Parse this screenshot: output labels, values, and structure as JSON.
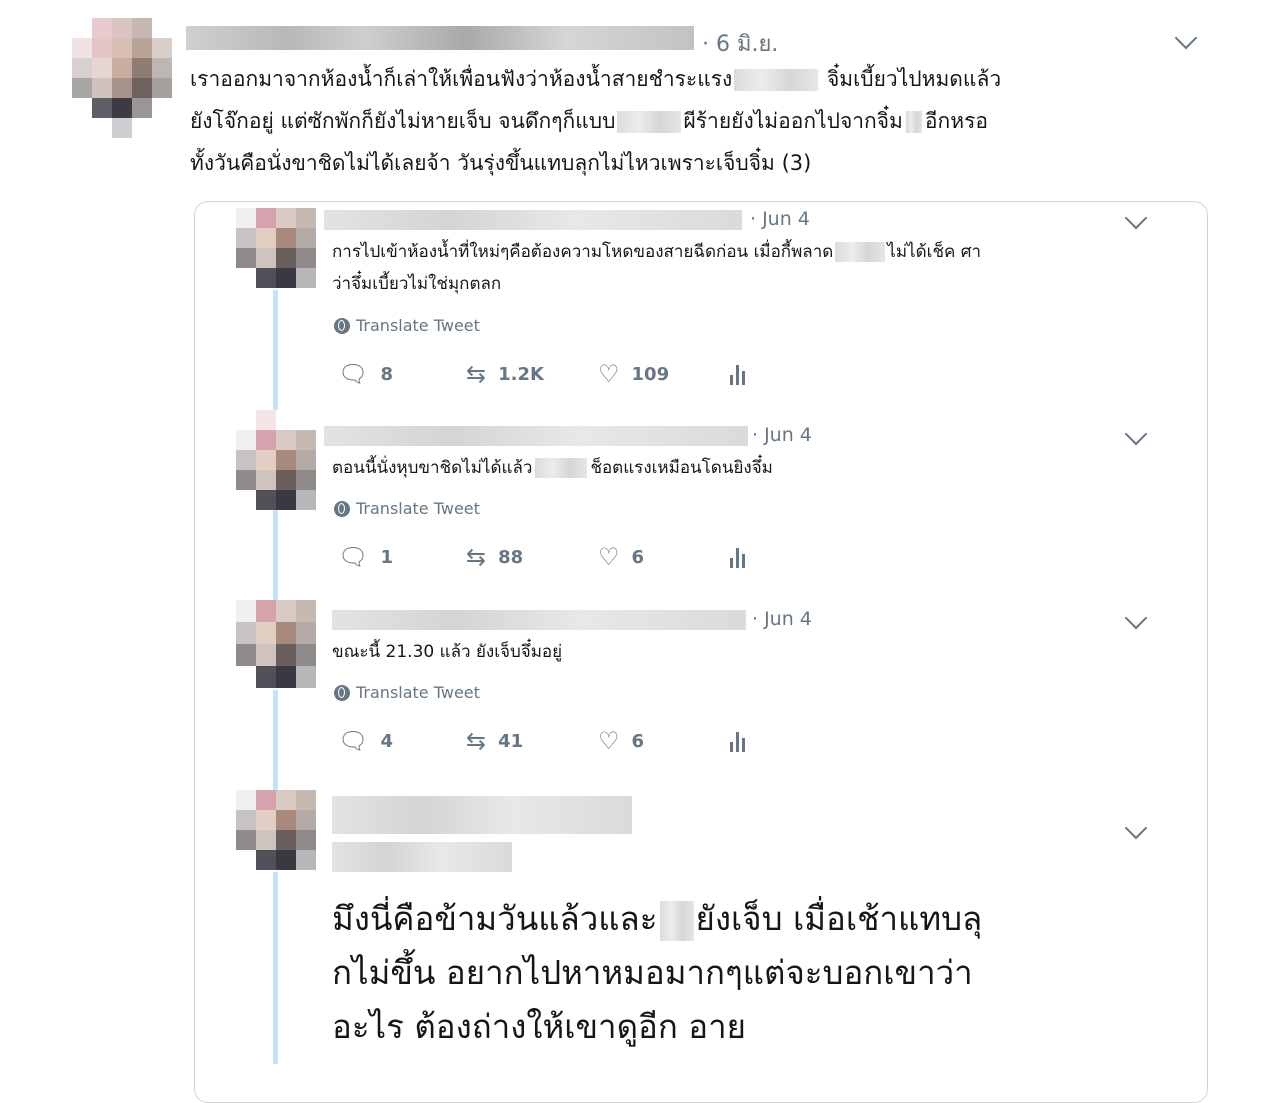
{
  "main_tweet": {
    "date": "· 6 มิ.ย.",
    "lines": [
      [
        "เราออกมาจากห้องน้ำก็เล่าให้เพื่อนฟังว่าห้องน้ำสายชำระแรง",
        " จิ๋มเบี้ยวไปหมดแล้ว"
      ],
      [
        "ยังโจ๊กอยู่ แต่ซักพักก็ยังไม่หายเจ็บ จนดึกๆก็แบบ",
        "ผีร้ายยังไม่ออกไปจากจิ๋ม",
        "อีกหรอ"
      ],
      [
        "ทั้งวันคือนั่งขาชิดไม่ได้เลยจ้า วันรุ่งขึ้นแทบลุกไม่ไหวเพราะเจ็บจิ๋ม (3)"
      ]
    ]
  },
  "replies": [
    {
      "date": "· Jun 4",
      "line1": "การไปเข้าห้องน้ำที่ใหม่ๆคือต้องความโหดของสายฉีดก่อน เมื่อกี้พลาด",
      "line1b": "ไม่ได้เช็ค ศา",
      "line2": "ว่าจึ๋มเบี้ยวไม่ใช่มุกตลก",
      "translate": "Translate Tweet",
      "replies": "8",
      "retweets": "1.2K",
      "likes": "109"
    },
    {
      "date": "· Jun 4",
      "line1": "ตอนนี้นั่งหุบขาชิดไม่ได้แล้ว",
      "line1b": "ช็อตแรงเหมือนโดนยิงจึ๋ม",
      "translate": "Translate Tweet",
      "replies": "1",
      "retweets": "88",
      "likes": "6"
    },
    {
      "date": "· Jun 4",
      "line1": "ขณะนี้ 21.30 แล้ว ยังเจ็บจึ๋มอยู่",
      "translate": "Translate Tweet",
      "replies": "4",
      "retweets": "41",
      "likes": "6"
    }
  ],
  "last_reply": {
    "lines": [
      [
        "มึงนี่คือข้ามวันแล้วและ",
        "ยังเจ็บ เมื่อเช้าแทบลุ"
      ],
      [
        "กไม่ขึ้น อยากไปหาหมอมากๆแต่จะบอกเขาว่า"
      ],
      [
        "อะไร ต้องถ่างให้เขาดูอีก อาย"
      ]
    ]
  },
  "icons": {
    "reply": "reply-icon",
    "retweet": "retweet-icon",
    "like": "heart-icon",
    "analytics": "analytics-icon",
    "translate": "globe-icon",
    "more": "chevron-down-icon"
  },
  "colors": {
    "muted": "#657786",
    "text": "#14171a",
    "thread": "#c4e3f8",
    "border": "#ccd6dd"
  }
}
